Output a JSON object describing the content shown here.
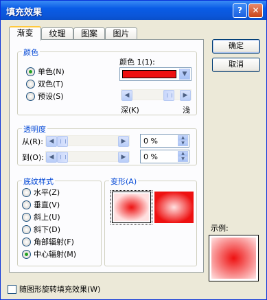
{
  "window": {
    "title": "填充效果",
    "help": "?",
    "close": "✕"
  },
  "tabs": [
    "渐变",
    "纹理",
    "图案",
    "图片"
  ],
  "colors": {
    "section_label": "颜色",
    "options": [
      {
        "label": "单色(N)",
        "selected": true
      },
      {
        "label": "双色(T)",
        "selected": false
      },
      {
        "label": "预设(S)",
        "selected": false
      }
    ],
    "color1_label": "颜色 1(1):",
    "color1_value": "#ee1111",
    "dark_label": "深(K)",
    "light_label": "浅",
    "shade_level": 0.85
  },
  "transparency": {
    "section_label": "透明度",
    "from_label": "从(R):",
    "to_label": "到(O):",
    "from_value": "0 %",
    "to_value": "0 %"
  },
  "shading_styles": {
    "section_label": "底纹样式",
    "options": [
      {
        "label": "水平(Z)",
        "selected": false
      },
      {
        "label": "垂直(V)",
        "selected": false
      },
      {
        "label": "斜上(U)",
        "selected": false
      },
      {
        "label": "斜下(D)",
        "selected": false
      },
      {
        "label": "角部辐射(F)",
        "selected": false
      },
      {
        "label": "中心辐射(M)",
        "selected": true
      }
    ]
  },
  "variants": {
    "section_label": "变形(A)"
  },
  "buttons": {
    "ok": "确定",
    "cancel": "取消"
  },
  "sample": {
    "label": "示例:"
  },
  "rotate_checkbox": {
    "label": "随图形旋转填充效果(W)",
    "checked": false
  }
}
